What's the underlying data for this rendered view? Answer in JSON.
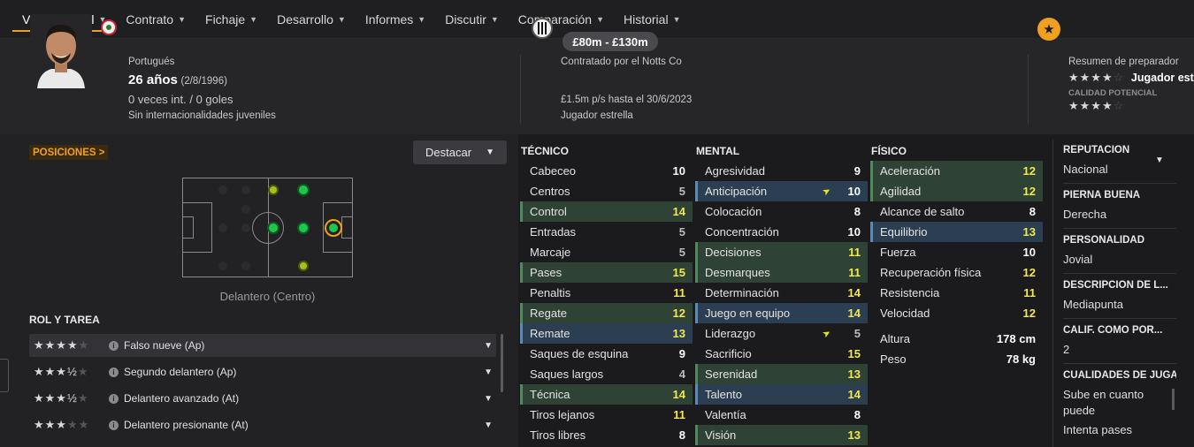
{
  "nav": {
    "tabs": [
      {
        "label": "Vista general"
      },
      {
        "label": "Contrato"
      },
      {
        "label": "Fichaje"
      },
      {
        "label": "Desarrollo"
      },
      {
        "label": "Informes"
      },
      {
        "label": "Discutir"
      },
      {
        "label": "Comparación"
      },
      {
        "label": "Historial"
      }
    ]
  },
  "player": {
    "nationality": "Portugués",
    "age": "26 años",
    "dob": "(2/8/1996)",
    "caps": "0 veces int. / 0 goles",
    "youth_caps": "Sin internacionalidades juveniles"
  },
  "contract": {
    "club": "Contratado por el Notts Co",
    "value_range": "£80m - £130m",
    "wage": "£1.5m p/s hasta el 30/6/2023",
    "status": "Jugador estrella"
  },
  "coach": {
    "title": "Resumen de preparador",
    "current_stars": "★★★★",
    "current_half": "☆",
    "current_label": "Jugador estr",
    "potential_label": "CALIDAD POTENCIAL",
    "potential_stars": "★★★★",
    "potential_half": "☆"
  },
  "positions": {
    "tag": "POSICIONES >",
    "highlight_button": "Destacar",
    "selected_label": "Delantero (Centro)"
  },
  "roles": {
    "title": "ROL Y TAREA",
    "items": [
      {
        "stars": "★★★★",
        "rest": "★",
        "label": "Falso nueve (Ap)"
      },
      {
        "stars": "★★★½",
        "rest": "★",
        "label": "Segundo delantero (Ap)"
      },
      {
        "stars": "★★★½",
        "rest": "★",
        "label": "Delantero avanzado (At)"
      },
      {
        "stars": "★★★",
        "rest": "★★",
        "label": "Delantero presionante (At)"
      }
    ]
  },
  "attributes": {
    "tecnico": {
      "title": "TÉCNICO",
      "rows": [
        {
          "name": "Cabeceo",
          "value": "10",
          "hl": "",
          "vc": "w"
        },
        {
          "name": "Centros",
          "value": "5",
          "hl": "",
          "vc": "gr"
        },
        {
          "name": "Control",
          "value": "14",
          "hl": "g",
          "vc": "y"
        },
        {
          "name": "Entradas",
          "value": "5",
          "hl": "",
          "vc": "gr"
        },
        {
          "name": "Marcaje",
          "value": "5",
          "hl": "",
          "vc": "gr"
        },
        {
          "name": "Pases",
          "value": "15",
          "hl": "g",
          "vc": "y"
        },
        {
          "name": "Penaltis",
          "value": "11",
          "hl": "",
          "vc": "y"
        },
        {
          "name": "Regate",
          "value": "12",
          "hl": "g",
          "vc": "y"
        },
        {
          "name": "Remate",
          "value": "13",
          "hl": "b",
          "vc": "y"
        },
        {
          "name": "Saques de esquina",
          "value": "9",
          "hl": "",
          "vc": "w"
        },
        {
          "name": "Saques largos",
          "value": "4",
          "hl": "",
          "vc": "gr"
        },
        {
          "name": "Técnica",
          "value": "14",
          "hl": "g",
          "vc": "y"
        },
        {
          "name": "Tiros lejanos",
          "value": "11",
          "hl": "",
          "vc": "y"
        },
        {
          "name": "Tiros libres",
          "value": "8",
          "hl": "",
          "vc": "w"
        }
      ]
    },
    "mental": {
      "title": "MENTAL",
      "rows": [
        {
          "name": "Agresividad",
          "value": "9",
          "hl": "",
          "vc": "w"
        },
        {
          "name": "Anticipación",
          "value": "10",
          "hl": "b",
          "vc": "w",
          "arrow": "➤"
        },
        {
          "name": "Colocación",
          "value": "8",
          "hl": "",
          "vc": "w"
        },
        {
          "name": "Concentración",
          "value": "10",
          "hl": "",
          "vc": "w"
        },
        {
          "name": "Decisiones",
          "value": "11",
          "hl": "g",
          "vc": "y"
        },
        {
          "name": "Desmarques",
          "value": "11",
          "hl": "g",
          "vc": "y"
        },
        {
          "name": "Determinación",
          "value": "14",
          "hl": "",
          "vc": "y"
        },
        {
          "name": "Juego en equipo",
          "value": "14",
          "hl": "b",
          "vc": "y"
        },
        {
          "name": "Liderazgo",
          "value": "5",
          "hl": "",
          "vc": "gr",
          "arrow": "➤"
        },
        {
          "name": "Sacrificio",
          "value": "15",
          "hl": "",
          "vc": "y"
        },
        {
          "name": "Serenidad",
          "value": "13",
          "hl": "g",
          "vc": "y"
        },
        {
          "name": "Talento",
          "value": "14",
          "hl": "b",
          "vc": "y"
        },
        {
          "name": "Valentía",
          "value": "8",
          "hl": "",
          "vc": "w"
        },
        {
          "name": "Visión",
          "value": "13",
          "hl": "g",
          "vc": "y"
        }
      ]
    },
    "fisico": {
      "title": "FÍSICO",
      "rows": [
        {
          "name": "Aceleración",
          "value": "12",
          "hl": "g",
          "vc": "y"
        },
        {
          "name": "Agilidad",
          "value": "12",
          "hl": "g",
          "vc": "y"
        },
        {
          "name": "Alcance de salto",
          "value": "8",
          "hl": "",
          "vc": "w"
        },
        {
          "name": "Equilibrio",
          "value": "13",
          "hl": "b",
          "vc": "y"
        },
        {
          "name": "Fuerza",
          "value": "10",
          "hl": "",
          "vc": "w"
        },
        {
          "name": "Recuperación física",
          "value": "12",
          "hl": "",
          "vc": "y"
        },
        {
          "name": "Resistencia",
          "value": "11",
          "hl": "",
          "vc": "y"
        },
        {
          "name": "Velocidad",
          "value": "12",
          "hl": "",
          "vc": "y"
        }
      ],
      "height_label": "Altura",
      "height_value": "178 cm",
      "weight_label": "Peso",
      "weight_value": "78 kg"
    }
  },
  "info": {
    "reputation_label": "REPUTACIÓN",
    "reputation_value": "Nacional",
    "foot_label": "PIERNA BUENA",
    "foot_value": "Derecha",
    "personality_label": "PERSONALIDAD",
    "personality_value": "Jovial",
    "description_label": "DESCRIPCIÓN DE L...",
    "description_value": "Mediapunta",
    "rating_label": "CALIF. COMO POR...",
    "rating_value": "2",
    "qualities_label": "CUALIDADES DE JUGA",
    "qualities_1": "Sube en cuanto puede",
    "qualities_2": "Intenta pases"
  },
  "colors": {
    "accent": "#f0a020",
    "attr_good_bg": "#2f4236",
    "attr_key_bg": "#2c3f52",
    "value_high": "#f2e94e"
  }
}
